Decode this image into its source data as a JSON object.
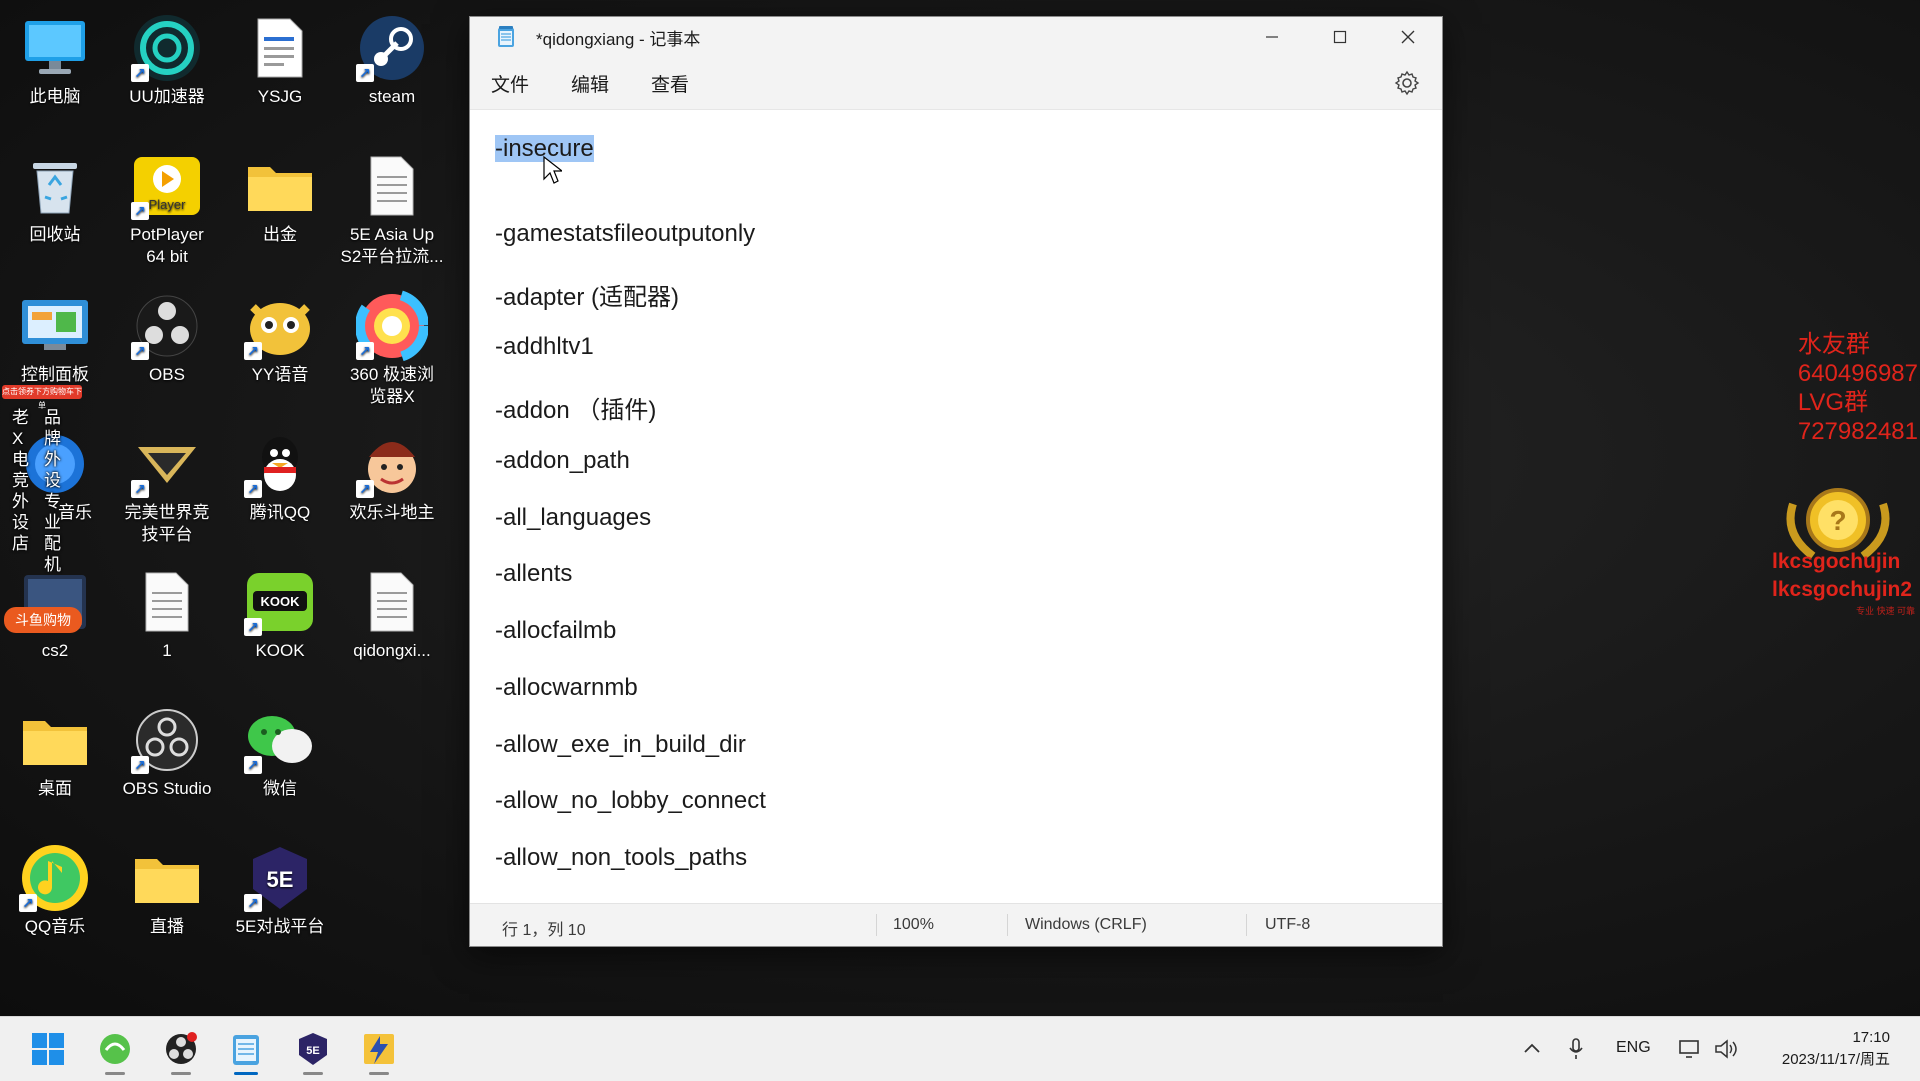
{
  "desktop": {
    "icons": [
      {
        "label": "此电脑"
      },
      {
        "label": "UU加速器"
      },
      {
        "label": "YSJG"
      },
      {
        "label": "steam"
      },
      {
        "label": "回收站"
      },
      {
        "label": "PotPlayer\n64 bit"
      },
      {
        "label": "出金"
      },
      {
        "label": "5E Asia Up\nS2平台拉流..."
      },
      {
        "label": "控制面板"
      },
      {
        "label": "OBS"
      },
      {
        "label": "YY语音"
      },
      {
        "label": "360 极速浏\n览器X"
      },
      {
        "label": "音乐"
      },
      {
        "label": "完美世界竞\n技平台"
      },
      {
        "label": "腾讯QQ"
      },
      {
        "label": "欢乐斗地主"
      },
      {
        "label": "cs2"
      },
      {
        "label": "1"
      },
      {
        "label": "KOOK"
      },
      {
        "label": "qidongxi..."
      },
      {
        "label": "桌面"
      },
      {
        "label": "OBS Studio"
      },
      {
        "label": "微信"
      },
      {
        "label": "QQ音乐"
      },
      {
        "label": "直播"
      },
      {
        "label": "5E对战平台"
      }
    ]
  },
  "notepad": {
    "title": "*qidongxiang - 记事本",
    "menu": [
      "文件",
      "编辑",
      "查看"
    ],
    "selected_text": "-insecure",
    "lines": [
      "-gamestatsfileoutputonly",
      "-adapter (适配器)",
      "-addhltv1",
      "-addon （插件)",
      "-addon_path",
      "-all_languages",
      "-allents",
      "-allocfailmb",
      "-allocwarnmb",
      "-allow_exe_in_build_dir",
      "-allow_no_lobby_connect",
      "-allow_non_tools_paths"
    ],
    "status": {
      "position": "行 1，列 10",
      "zoom": "100%",
      "line_ending": "Windows (CRLF)",
      "encoding": "UTF-8"
    }
  },
  "overlay": {
    "group_lines": [
      "水友群",
      "640496987",
      "LVG群",
      "727982481"
    ],
    "brand_lines": [
      "lkcsgochujin",
      "lkcsgochujin2"
    ],
    "brand_small": "专业 快速 可靠"
  },
  "promo": {
    "top_banner": "点击领券下方购物车下单",
    "col1": "老X电竞外设店",
    "col2": "品牌外设专业配机",
    "badge": "斗鱼购物"
  },
  "taskbar": {
    "tray_language": "ENG",
    "time": "17:10",
    "date": "2023/11/17/周五"
  }
}
